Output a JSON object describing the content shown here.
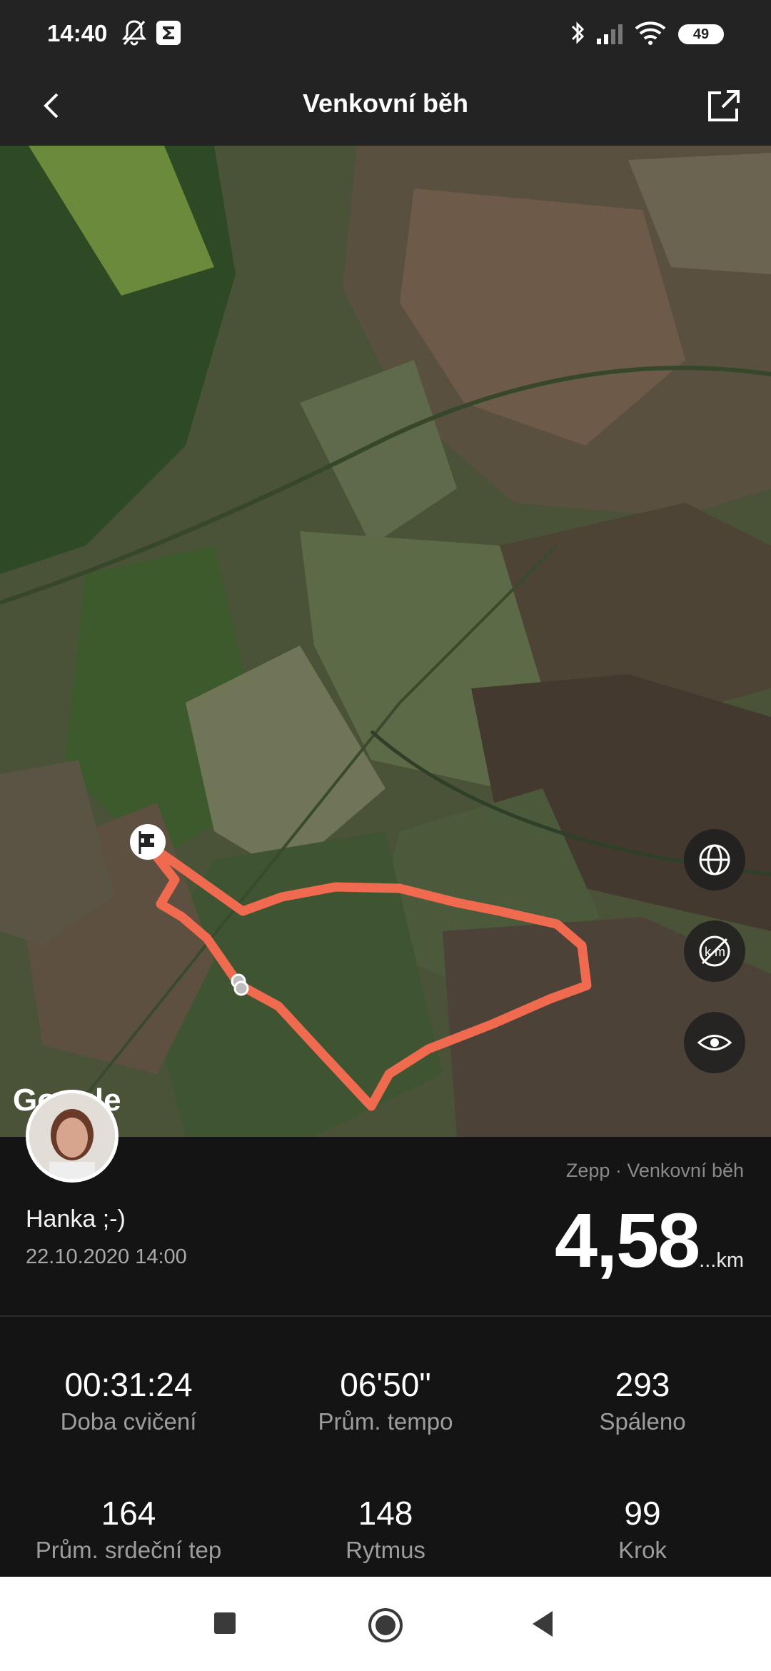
{
  "status_bar": {
    "time": "14:40",
    "battery": "49"
  },
  "app_bar": {
    "title": "Venkovní běh"
  },
  "map": {
    "attribution": "Google",
    "route_color": "#f06a4f"
  },
  "user": {
    "name": "Hanka ;-)",
    "date": "22.10.2020 14:00"
  },
  "summary": {
    "source": "Zepp · Venkovní běh",
    "distance": "4,58",
    "unit": "...km"
  },
  "stats": [
    {
      "value": "00:31:24",
      "label": "Doba cvičení"
    },
    {
      "value": "06'50\"",
      "label": "Prům. tempo"
    },
    {
      "value": "293",
      "label": "Spáleno"
    },
    {
      "value": "164",
      "label": "Prům. srdeční tep"
    },
    {
      "value": "148",
      "label": "Rytmus"
    },
    {
      "value": "99",
      "label": "Krok"
    }
  ]
}
